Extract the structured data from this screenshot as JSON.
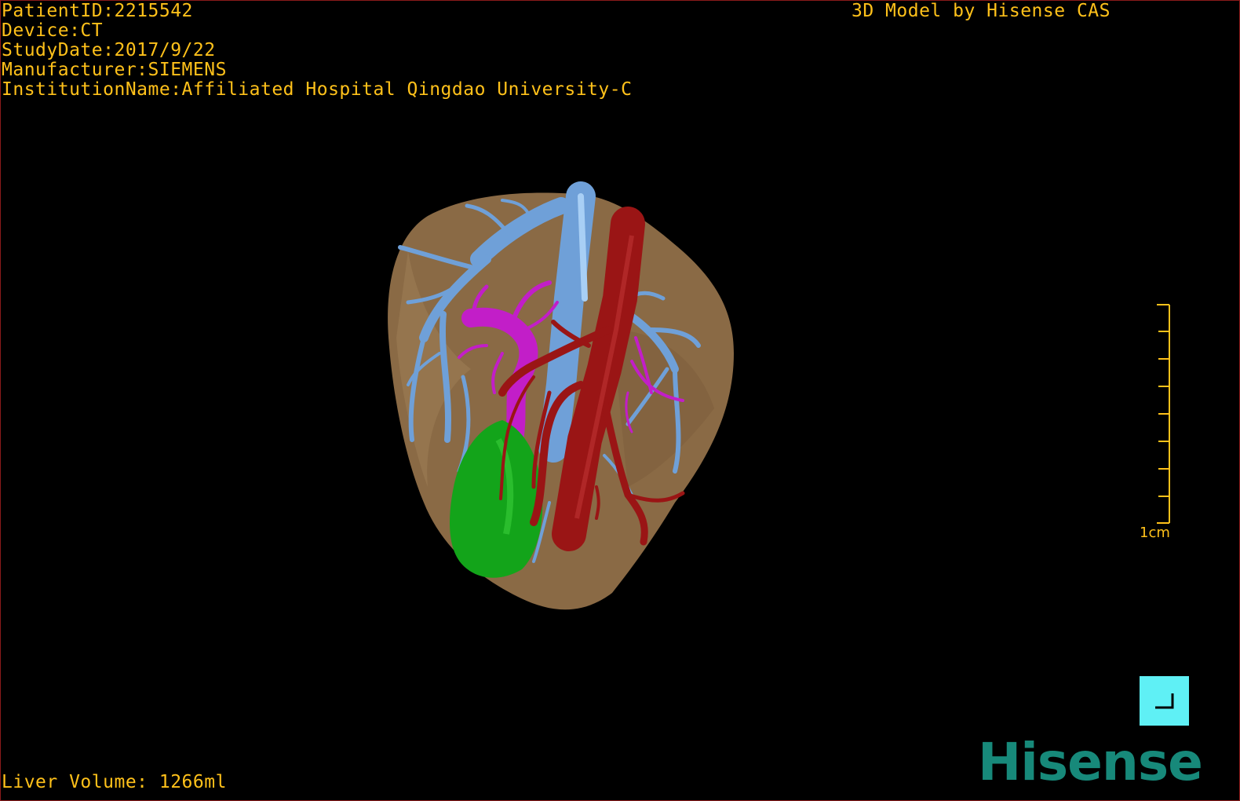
{
  "info": {
    "patient_id": "PatientID:2215542",
    "device": "Device:CT",
    "study_date": "StudyDate:2017/9/22",
    "manufacturer": "Manufacturer:SIEMENS",
    "institution": "InstitutionName:Affiliated Hospital Qingdao University-C"
  },
  "credit": "3D Model by Hisense CAS",
  "volume": "Liver Volume: 1266ml",
  "scale": {
    "label": "1cm",
    "unit_length": "1cm"
  },
  "logo": "Hisense",
  "colors": {
    "text": "#ffc11a",
    "liver": "#8a6a45",
    "portal_vein": "#6fa0d8",
    "hepatic_artery": "#9a1515",
    "bile_duct": "#c21ec8",
    "gallbladder": "#13a41a",
    "orient_button": "#5ff0f5",
    "logo": "#17897a"
  },
  "icons": {
    "orientation": "orientation-reset-icon"
  }
}
